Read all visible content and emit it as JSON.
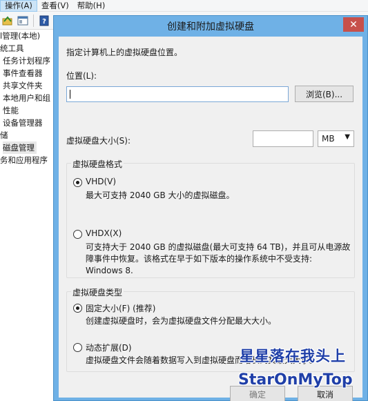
{
  "menubar": {
    "items": [
      {
        "label": "操作(A)",
        "active": true
      },
      {
        "label": "查看(V)",
        "active": false
      },
      {
        "label": "帮助(H)",
        "active": false
      }
    ]
  },
  "tree": {
    "items": [
      {
        "label": "l管理(本地)",
        "indent": 0
      },
      {
        "label": "统工具",
        "indent": 0
      },
      {
        "label": "任务计划程序",
        "indent": 4
      },
      {
        "label": "事件查看器",
        "indent": 4
      },
      {
        "label": "共享文件夹",
        "indent": 4
      },
      {
        "label": "本地用户和组",
        "indent": 4
      },
      {
        "label": "性能",
        "indent": 4
      },
      {
        "label": "设备管理器",
        "indent": 4
      },
      {
        "label": "储",
        "indent": 0
      },
      {
        "label": "磁盘管理",
        "indent": 4,
        "selected": true
      },
      {
        "label": "务和应用程序",
        "indent": 0
      }
    ]
  },
  "dialog": {
    "title": "创建和附加虚拟硬盘",
    "close_glyph": "✕",
    "instruction": "指定计算机上的虚拟硬盘位置。",
    "location_label": "位置(L):",
    "location_value": "",
    "browse_label": "浏览(B)...",
    "size_label": "虚拟硬盘大小(S):",
    "size_value": "",
    "size_unit": "MB",
    "format_group": {
      "title": "虚拟硬盘格式",
      "options": [
        {
          "label": "VHD(V)",
          "selected": true,
          "desc": [
            "最大可支持 2040 GB 大小的虚拟磁盘。"
          ]
        },
        {
          "label": "VHDX(X)",
          "selected": false,
          "desc": [
            "可支持大于 2040 GB 的虚拟磁盘(最大可支持 64 TB)，并且可从电源故",
            "障事件中恢复。该格式在早于如下版本的操作系统中不受支持:",
            "Windows 8."
          ]
        }
      ]
    },
    "type_group": {
      "title": "虚拟硬盘类型",
      "options": [
        {
          "label": "固定大小(F) (推荐)",
          "selected": true,
          "desc": [
            "创建虚拟硬盘时，会为虚拟硬盘文件分配最大大小。"
          ]
        },
        {
          "label": "动态扩展(D)",
          "selected": false,
          "desc": [
            "虚拟硬盘文件会随着数据写入到虚拟硬盘而增长到其最大大小。"
          ]
        }
      ]
    },
    "ok_label": "确定",
    "cancel_label": "取消"
  },
  "watermark": {
    "line1": "星星落在我头上",
    "line2": "StarOnMyTop"
  }
}
